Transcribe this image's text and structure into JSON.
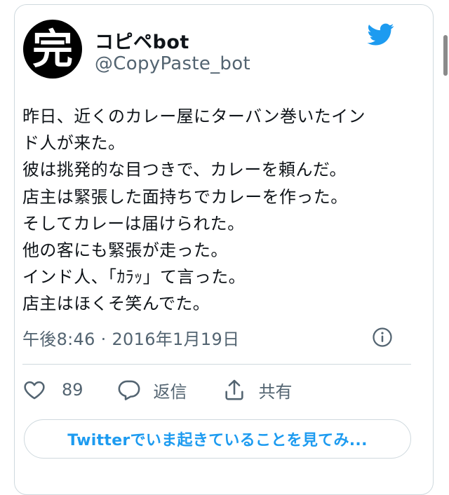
{
  "author": {
    "avatar_glyph": "完",
    "display_name": "コピペbot",
    "handle": "@CopyPaste_bot"
  },
  "tweet": {
    "lines": [
      "昨日、近くのカレー屋にターバン巻いたイン",
      "ド人が来た。",
      "彼は挑発的な目つきで、カレーを頼んだ。",
      "店主は緊張した面持ちでカレーを作った。",
      "そしてカレーは届けられた。",
      "他の客にも緊張が走った。",
      "インド人、「ｶﾗｯ」て言った。",
      "店主はほくそ笑んでた。"
    ],
    "timestamp": "午後8:46 · 2016年1月19日"
  },
  "actions": {
    "like_count": "89",
    "reply_label": "返信",
    "share_label": "共有"
  },
  "cta": {
    "label": "Twitterでいま起きていることを見てみ..."
  },
  "colors": {
    "accent": "#1d9bf0",
    "text": "#0f1419",
    "secondary": "#536471",
    "border": "#cfd9de"
  },
  "icons": [
    "twitter-bird-icon",
    "info-icon",
    "heart-icon",
    "reply-icon",
    "share-icon"
  ]
}
